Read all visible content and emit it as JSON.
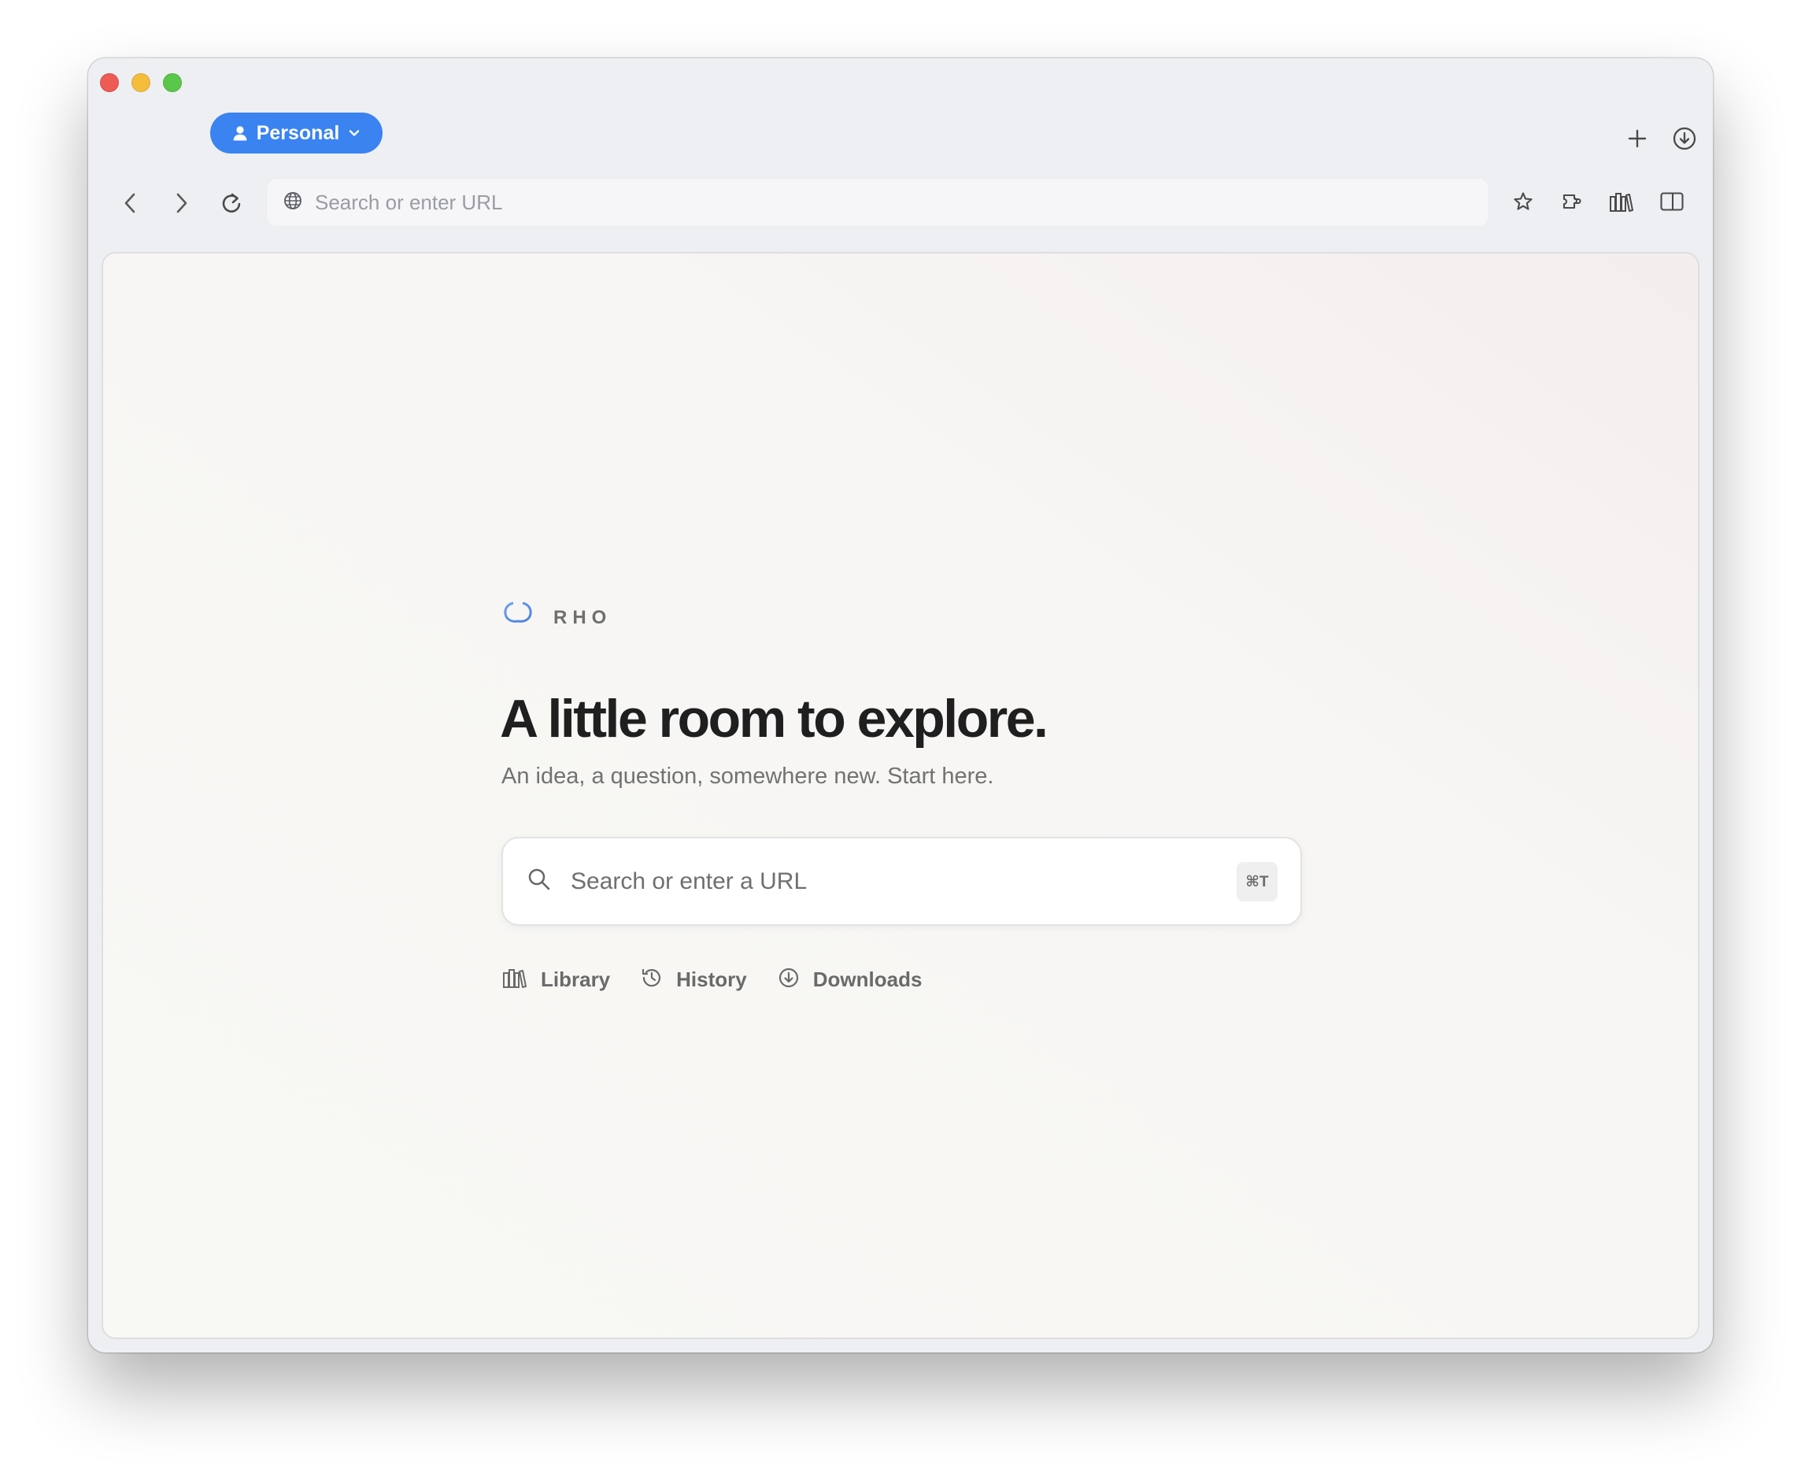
{
  "window": {
    "traffic_lights": [
      "close",
      "minimize",
      "maximize"
    ],
    "colors": {
      "close": "#ee5b55",
      "minimize": "#f4bd3c",
      "maximize": "#5ac64a"
    }
  },
  "tabbar": {
    "profile_label": "Personal",
    "profile_icon": "person-icon",
    "profile_color": "#3a83f1",
    "right_icons": [
      "plus-icon",
      "download-circle-icon"
    ]
  },
  "toolbar": {
    "nav_icons": [
      "back-arrow-icon",
      "forward-arrow-icon",
      "reload-icon"
    ],
    "url_placeholder": "Search or enter URL",
    "right_icons": [
      "star-icon",
      "extension-icon",
      "library-icon",
      "sidebar-icon"
    ]
  },
  "newtab": {
    "brand_glyph": "φ",
    "brand_name": "RHO",
    "headline": "A little room to explore.",
    "subhead": "An idea, a question, somewhere new. Start here.",
    "search_placeholder": "Search or enter a URL",
    "shortcut": "⌘T",
    "quick_links": [
      {
        "label": "Library",
        "icon": "library-icon"
      },
      {
        "label": "History",
        "icon": "history-icon"
      },
      {
        "label": "Downloads",
        "icon": "download-circle-icon"
      }
    ]
  }
}
